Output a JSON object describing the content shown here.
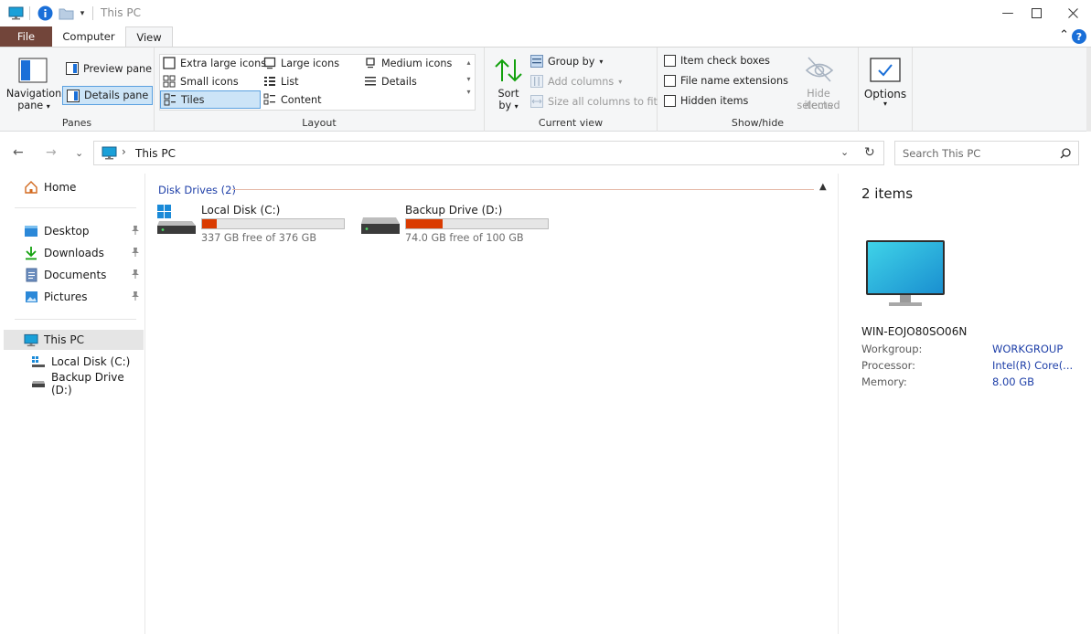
{
  "window": {
    "title": "This PC"
  },
  "tabs": {
    "file": "File",
    "computer": "Computer",
    "view": "View"
  },
  "ribbon": {
    "panes": {
      "label": "Panes",
      "navigation_pane": "Navigation",
      "navigation_pane_2": "pane",
      "preview_pane": "Preview pane",
      "details_pane": "Details pane"
    },
    "layout": {
      "label": "Layout",
      "extra_large_icons": "Extra large icons",
      "large_icons": "Large icons",
      "medium_icons": "Medium icons",
      "small_icons": "Small icons",
      "list": "List",
      "details": "Details",
      "tiles": "Tiles",
      "content": "Content"
    },
    "current_view": {
      "label": "Current view",
      "sort_by": "Sort",
      "sort_by_2": "by",
      "group_by": "Group by",
      "add_columns": "Add columns",
      "size_all_columns": "Size all columns to fit"
    },
    "show_hide": {
      "label": "Show/hide",
      "item_check_boxes": "Item check boxes",
      "file_name_extensions": "File name extensions",
      "hidden_items": "Hidden items",
      "hide_selected": "Hide selected",
      "hide_selected_2": "items"
    },
    "options": {
      "label": "Options"
    }
  },
  "address": {
    "path": "This PC",
    "search_placeholder": "Search This PC"
  },
  "nav": {
    "home": "Home",
    "desktop": "Desktop",
    "downloads": "Downloads",
    "documents": "Documents",
    "pictures": "Pictures",
    "this_pc": "This PC",
    "local_disk": "Local Disk (C:)",
    "backup_drive": "Backup Drive (D:)"
  },
  "content": {
    "group_header": "Disk Drives (2)",
    "drives": [
      {
        "name": "Local Disk (C:)",
        "free_text": "337 GB free of 376 GB",
        "used_fraction": 0.104
      },
      {
        "name": "Backup Drive (D:)",
        "free_text": "74.0 GB free of 100 GB",
        "used_fraction": 0.26
      }
    ]
  },
  "details": {
    "count": "2 items",
    "computer_name": "WIN-EOJO80SO06N",
    "props": [
      {
        "key": "Workgroup:",
        "value": "WORKGROUP"
      },
      {
        "key": "Processor:",
        "value": "Intel(R) Core(..."
      },
      {
        "key": "Memory:",
        "value": "8.00 GB"
      }
    ]
  },
  "colors": {
    "file_tab": "#72453a",
    "accent": "#1e3fa8",
    "drive_bar": "#da3b01"
  }
}
